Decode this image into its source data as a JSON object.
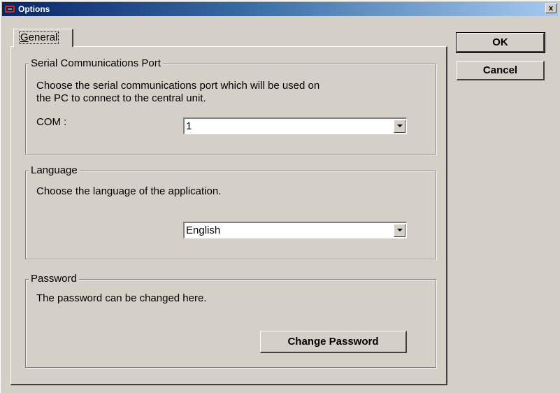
{
  "window": {
    "title": "Options",
    "close_glyph": "x"
  },
  "tabs": [
    {
      "label_first": "G",
      "label_rest": "eneral",
      "selected": true
    }
  ],
  "buttons": {
    "ok": "OK",
    "cancel": "Cancel"
  },
  "serial": {
    "title": "Serial Communications Port",
    "description_line1": "Choose the serial communications port which will be used on",
    "description_line2": "the PC to connect to the central unit.",
    "com_label": "COM :",
    "com_value": "1"
  },
  "language": {
    "title": "Language",
    "description": "Choose the language of the application.",
    "value": "English"
  },
  "password": {
    "title": "Password",
    "description": "The password can be changed here.",
    "change_button": "Change Password"
  },
  "icons": {
    "app": "app-icon",
    "close": "close-icon",
    "dropdown": "chevron-down-icon"
  },
  "colors": {
    "face": "#d4d0c8",
    "title_start": "#0a246a",
    "title_end": "#a6caf0"
  }
}
